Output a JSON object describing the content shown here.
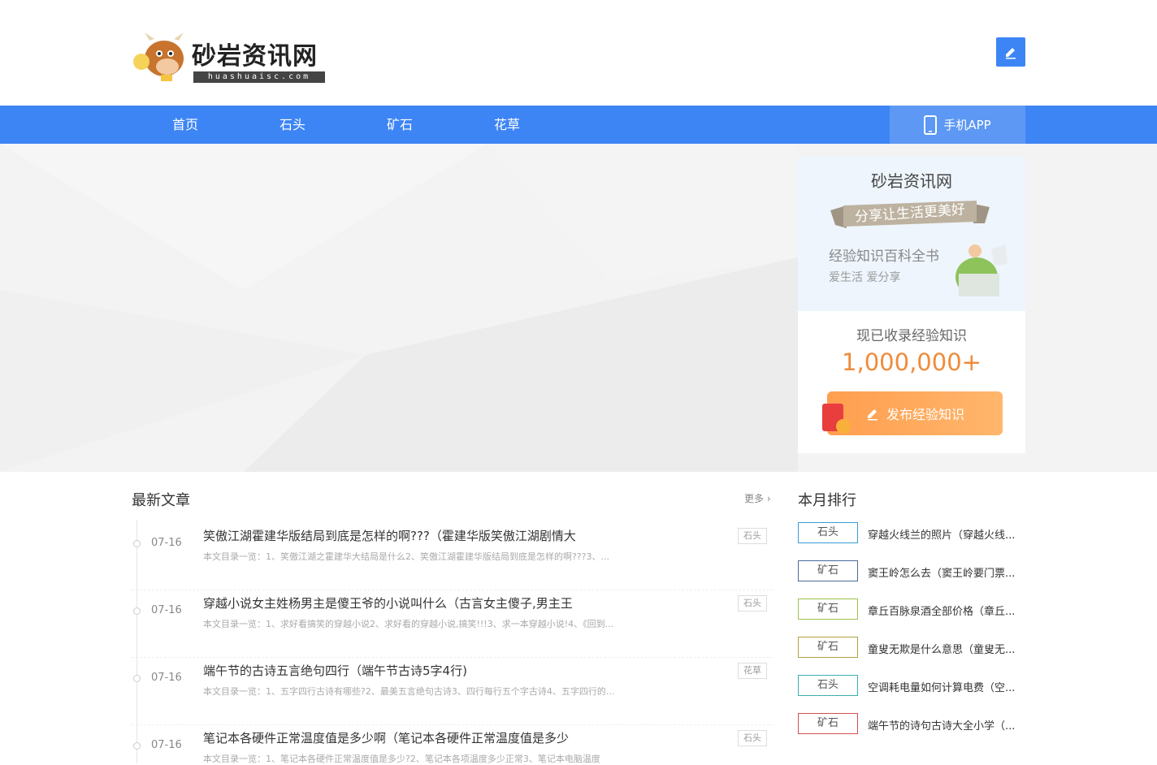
{
  "site": {
    "name": "砂岩资讯网",
    "domain": "huashuaisc.com"
  },
  "nav": {
    "items": [
      "首页",
      "石头",
      "矿石",
      "花草"
    ],
    "app_label": "手机APP"
  },
  "sidebar": {
    "title": "砂岩资讯网",
    "ribbon": "分享让生活更美好",
    "sub1": "经验知识百科全书",
    "sub2": "爱生活 爱分享",
    "count_label": "现已收录经验知识",
    "count": "1,000,000+",
    "publish_label": "发布经验知识"
  },
  "latest": {
    "title": "最新文章",
    "more": "更多",
    "articles": [
      {
        "date": "07-16",
        "title": "笑傲江湖霍建华版结局到底是怎样的啊???（霍建华版笑傲江湖剧情大",
        "excerpt": "本文目录一览：1、笑傲江湖之霍建华大结局是什么2、笑傲江湖霍建华版结局到底是怎样的啊???3、...",
        "tag": "石头"
      },
      {
        "date": "07-16",
        "title": "穿越小说女主姓杨男主是傻王爷的小说叫什么（古言女主傻子,男主王",
        "excerpt": "本文目录一览：1、求好看搞笑的穿越小说2、求好看的穿越小说,搞笑!!!3、求一本穿越小说!4、《回到...",
        "tag": "石头"
      },
      {
        "date": "07-16",
        "title": "端午节的古诗五言绝句四行（端午节古诗5字4行)",
        "excerpt": "本文目录一览：1、五字四行古诗有哪些?2、最美五言绝句古诗3、四行每行五个字古诗4、五字四行的...",
        "tag": "花草"
      },
      {
        "date": "07-16",
        "title": "笔记本各硬件正常温度值是多少啊（笔记本各硬件正常温度值是多少",
        "excerpt": "本文目录一览：1、笔记本各硬件正常温度值是多少?2、笔记本各项温度多少正常3、笔记本电脑温度",
        "tag": "石头"
      }
    ]
  },
  "ranking": {
    "title": "本月排行",
    "items": [
      {
        "tag": "石头",
        "color": "#3a9bd8",
        "text": "穿越火线兰的照片（穿越火线..."
      },
      {
        "tag": "矿石",
        "color": "#4a6a9a",
        "text": "窦王岭怎么去（窦王岭要门票..."
      },
      {
        "tag": "矿石",
        "color": "#9cc24a",
        "text": "章丘百脉泉酒全部价格（章丘..."
      },
      {
        "tag": "矿石",
        "color": "#b0a040",
        "text": "童叟无欺是什么意思（童叟无..."
      },
      {
        "tag": "石头",
        "color": "#3ab0b0",
        "text": "空调耗电量如何计算电费（空..."
      },
      {
        "tag": "矿石",
        "color": "#d05050",
        "text": "端午节的诗句古诗大全小学（..."
      }
    ]
  },
  "colors": {
    "primary": "#3d85f5",
    "accent": "#f08b3a"
  }
}
